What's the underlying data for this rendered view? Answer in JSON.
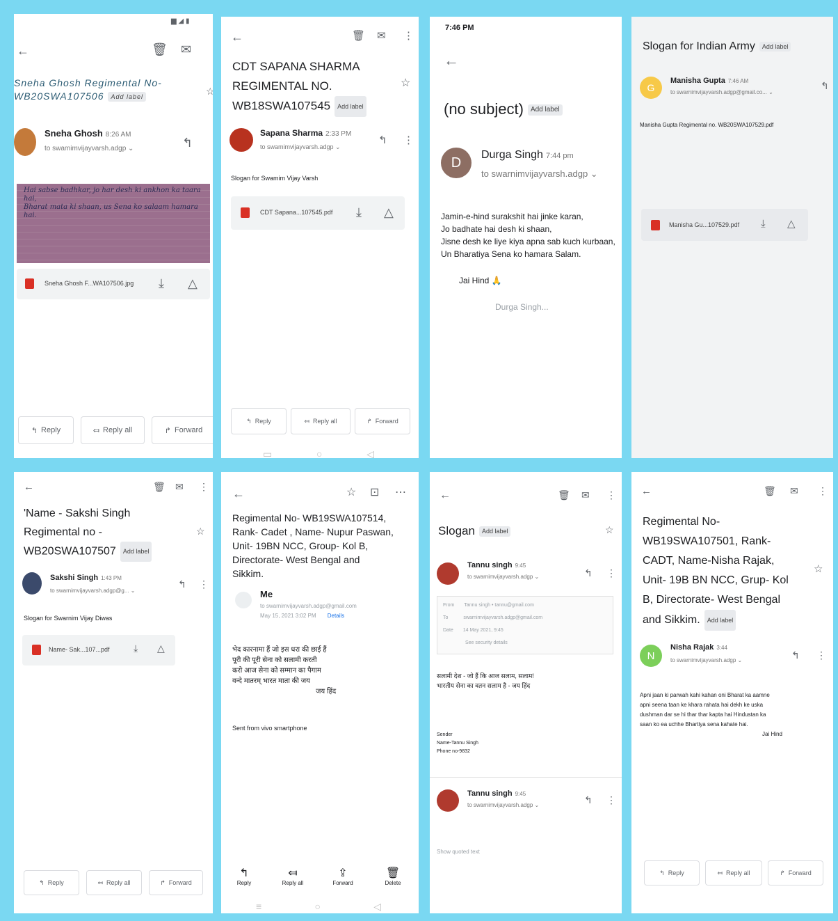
{
  "colors": {
    "frame": "#7ad8f2",
    "label_bg": "#e8eaed",
    "pdf_red": "#d93025"
  },
  "icons": [
    "back-arrow-icon",
    "trash-icon",
    "mail-icon",
    "more-vert-icon",
    "star-icon",
    "reply-icon",
    "reply-all-icon",
    "forward-icon",
    "download-icon",
    "drive-icon",
    "pdf-icon",
    "image-icon"
  ],
  "common": {
    "add_label": "Add label",
    "reply": "Reply",
    "reply_all": "Reply all",
    "forward": "Forward"
  },
  "p1": {
    "subject_line1": "Sneha Ghosh Regimental No-",
    "subject_line2": "WB20SWA107506",
    "sender": "Sneha Ghosh",
    "time": "8:26 AM",
    "to": "to swamimvijayvarsh.adgp",
    "attachment": "Sneha Ghosh F...WA107506.jpg",
    "handwriting1": "Hai sabse badhkar, jo har desh ki ankhon ka taara hai,",
    "handwriting2": "Bharat mata ki shaan, us Sena ko salaam hamara hai."
  },
  "p2": {
    "subject_line1": "CDT SAPANA SHARMA",
    "subject_line2": "REGIMENTAL NO.",
    "subject_line3": "WB18SWA107545",
    "sender": "Sapana Sharma",
    "time": "2:33 PM",
    "to": "to swamimvijayvarsh.adgp",
    "body": "Slogan for Swamim Vijay Varsh",
    "attachment": "CDT Sapana...107545.pdf"
  },
  "p3": {
    "status_time": "7:46 PM",
    "subject": "(no subject)",
    "sender": "Durga Singh",
    "time": "7:44 pm",
    "avatar_letter": "D",
    "to": "to swarnimvijayvarsh.adgp",
    "line1": "Jamin-e-hind surakshit hai jinke karan,",
    "line2": "Jo badhate hai desh ki shaan,",
    "line3": "Jisne desh ke liye kiya apna sab kuch kurbaan,",
    "line4": "Un Bharatiya Sena ko hamara Salam.",
    "jai_hind": "Jai Hind",
    "signature": "Durga Singh..."
  },
  "p4": {
    "subject": "Slogan for Indian Army",
    "sender": "Manisha Gupta",
    "time": "7:46 AM",
    "avatar_letter": "G",
    "to": "to swarnimvijayvarsh.adgp@gmail.co...",
    "body": "Manisha Gupta Regimental no. WB20SWA107529.pdf",
    "attachment": "Manisha Gu...107529.pdf"
  },
  "p5": {
    "subject_line1": "'Name - Sakshi Singh",
    "subject_line2": "Regimental no -",
    "subject_line3": "WB20SWA107507",
    "sender": "Sakshi Singh",
    "time": "1:43 PM",
    "to": "to swarnimvijayvarsh.adgp@g...",
    "body": "Slogan for Swarnim Vijay Diwas",
    "attachment": "Name- Sak...107...pdf"
  },
  "p6": {
    "subject_line1": "Regimental No- WB19SWA107514,",
    "subject_line2": "Rank- Cadet , Name- Nupur Paswan,",
    "subject_line3": "Unit- 19BN NCC, Group- Kol B,",
    "subject_line4": "Directorate- West Bengal and",
    "subject_line5": "Sikkim.",
    "sender": "Me",
    "to": "to swarnimvijayvarsh.adgp@gmail.com",
    "date": "May 15, 2021 3:02 PM",
    "details": "Details",
    "poem1": "भेद कारनामा हैं जो इस धरा की छाई हैं",
    "poem2": "पूरी की पूरी सेना को सलामी करती",
    "poem3": "करो आज सेना को सम्मान का पैगाम",
    "poem4": "वन्दे मातरम् भारत माता की जय",
    "poem_sign": "जय हिंद",
    "sent_from": "Sent from vivo smartphone",
    "bottom_reply": "Reply",
    "bottom_reply_all": "Reply all",
    "bottom_forward": "Forward",
    "bottom_delete": "Delete"
  },
  "p7": {
    "subject": "Slogan",
    "sender": "Tannu singh",
    "time": "9:45",
    "to": "to swarnimvijayvarsh.adgp",
    "from_label": "From",
    "from_val": "Tannu singh • tannu@gmail.com",
    "to_label": "To",
    "to_val": "swarnimvijayvarsh.adgp@gmail.com",
    "date_label": "Date",
    "date_val": "14 May 2021, 9:45",
    "security": "See security details",
    "body1": "सलामी देश - जो हैं कि आज सलाम, सलाम!",
    "body2": "भारतीय सेना का वतन सलाम है - जय हिंद",
    "sign1": "Sender",
    "sign2": "Name-Tannu Singh",
    "sign3": "Phone no-9832",
    "sender2": "Tannu singh",
    "time2": "9:45",
    "to2": "to swarnimvijayvarsh.adgp",
    "quoted": "Show quoted text"
  },
  "p8": {
    "subject_line1": "Regimental No-",
    "subject_line2": "WB19SWA107501, Rank-",
    "subject_line3": "CADT, Name-Nisha Rajak,",
    "subject_line4": "Unit- 19B BN NCC, Grup- Kol",
    "subject_line5": "B, Directorate- West Bengal",
    "subject_line6": "and Sikkim.",
    "sender": "Nisha Rajak",
    "time": "3:44",
    "avatar_letter": "N",
    "to": "to swarnimvijayvarsh.adgp",
    "body1": "Apni jaan ki parwah kahi kahan oni Bharat ka aamne",
    "body2": "apni seena taan ke khara rahata hai dekh ke uska",
    "body3": "dushman dar se hi thar thar kapta hai Hindustan ka",
    "body4": "saan ko ea uchhe Bhartiya sena kahate hai.",
    "jai_hind": "Jai Hind"
  }
}
